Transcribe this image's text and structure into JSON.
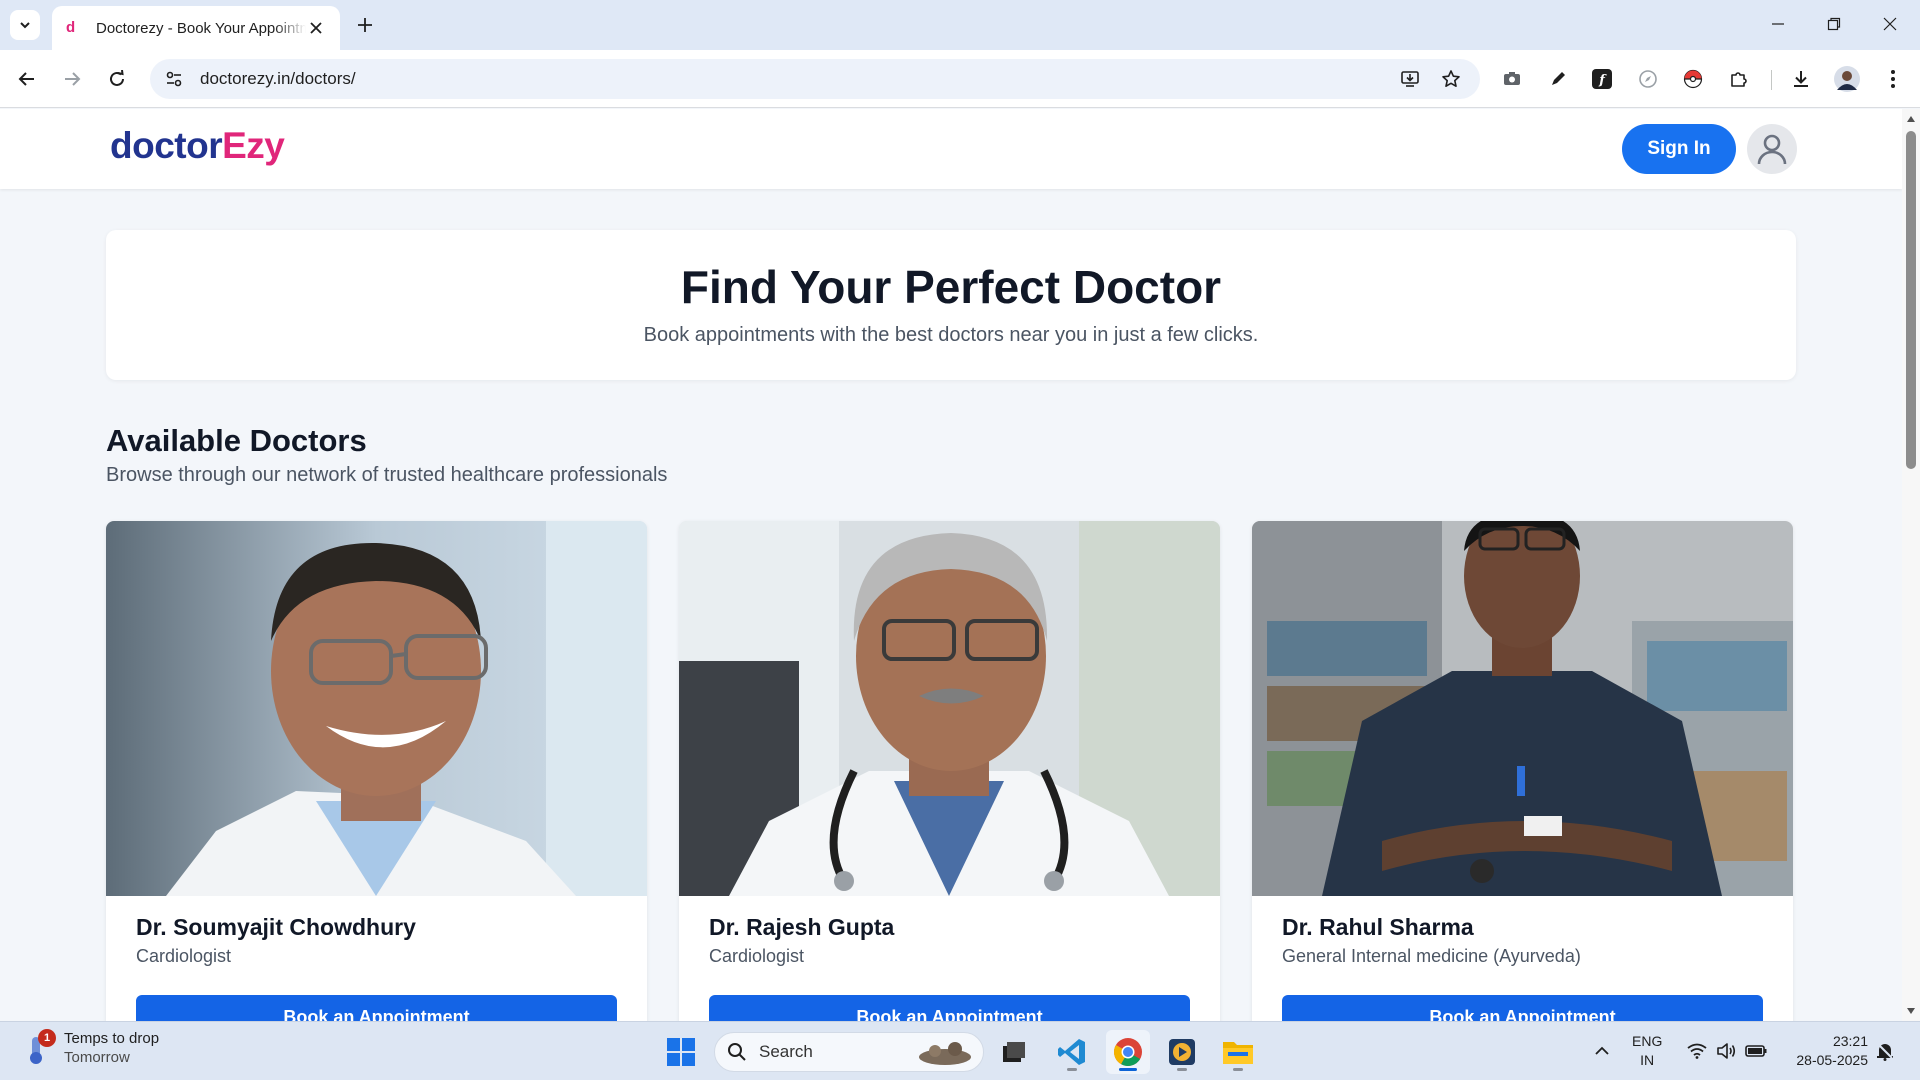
{
  "browser": {
    "tab_title": "Doctorezy - Book Your Appointment",
    "url": "doctorezy.in/doctors/"
  },
  "site": {
    "logo_part1": "doctor",
    "logo_part2": "Ezy",
    "signin_label": "Sign In"
  },
  "hero": {
    "title": "Find Your Perfect Doctor",
    "subtitle": "Book appointments with the best doctors near you in just a few clicks."
  },
  "section": {
    "title": "Available Doctors",
    "subtitle": "Browse through our network of trusted healthcare professionals"
  },
  "doctors": [
    {
      "name": "Dr. Soumyajit Chowdhury",
      "specialty": "Cardiologist",
      "button": "Book an Appointment"
    },
    {
      "name": "Dr. Rajesh Gupta",
      "specialty": "Cardiologist",
      "button": "Book an Appointment"
    },
    {
      "name": "Dr. Rahul Sharma",
      "specialty": "General Internal medicine (Ayurveda)",
      "button": "Book an Appointment"
    }
  ],
  "taskbar": {
    "weather_badge": "1",
    "weather_line1": "Temps to drop",
    "weather_line2": "Tomorrow",
    "search_label": "Search",
    "lang_line1": "ENG",
    "lang_line2": "IN",
    "time": "23:21",
    "date": "28-05-2025"
  },
  "colors": {
    "brand_blue": "#1872f0",
    "logo_navy": "#22348f",
    "logo_pink": "#e0267a"
  }
}
